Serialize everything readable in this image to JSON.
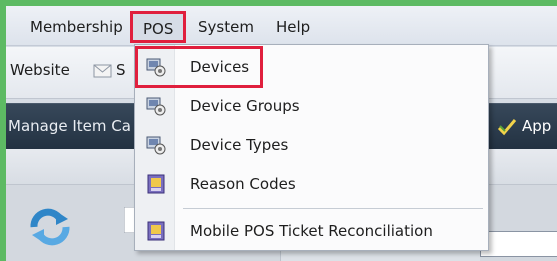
{
  "colors": {
    "highlight": "#e01f3d",
    "outer_border": "#5dba63",
    "darkbar": "#2c3c4d"
  },
  "menubar": {
    "items": [
      {
        "label": "Membership"
      },
      {
        "label": "POS"
      },
      {
        "label": "System"
      },
      {
        "label": "Help"
      }
    ]
  },
  "toolbar": {
    "website_label": "Website",
    "truncated_label": "S",
    "icon": "envelope-icon"
  },
  "darkbar": {
    "left_label": "Manage Item Ca",
    "right_label": "App",
    "right_icon": "pencil-check-icon"
  },
  "dropdown": {
    "items": [
      {
        "label": "Devices",
        "icon": "device-icon"
      },
      {
        "label": "Device Groups",
        "icon": "device-icon"
      },
      {
        "label": "Device Types",
        "icon": "device-icon"
      },
      {
        "label": "Reason Codes",
        "icon": "register-icon"
      },
      {
        "label": "Mobile POS Ticket Reconciliation",
        "icon": "register-icon"
      }
    ]
  },
  "lower": {
    "refresh_icon": "refresh-icon"
  }
}
